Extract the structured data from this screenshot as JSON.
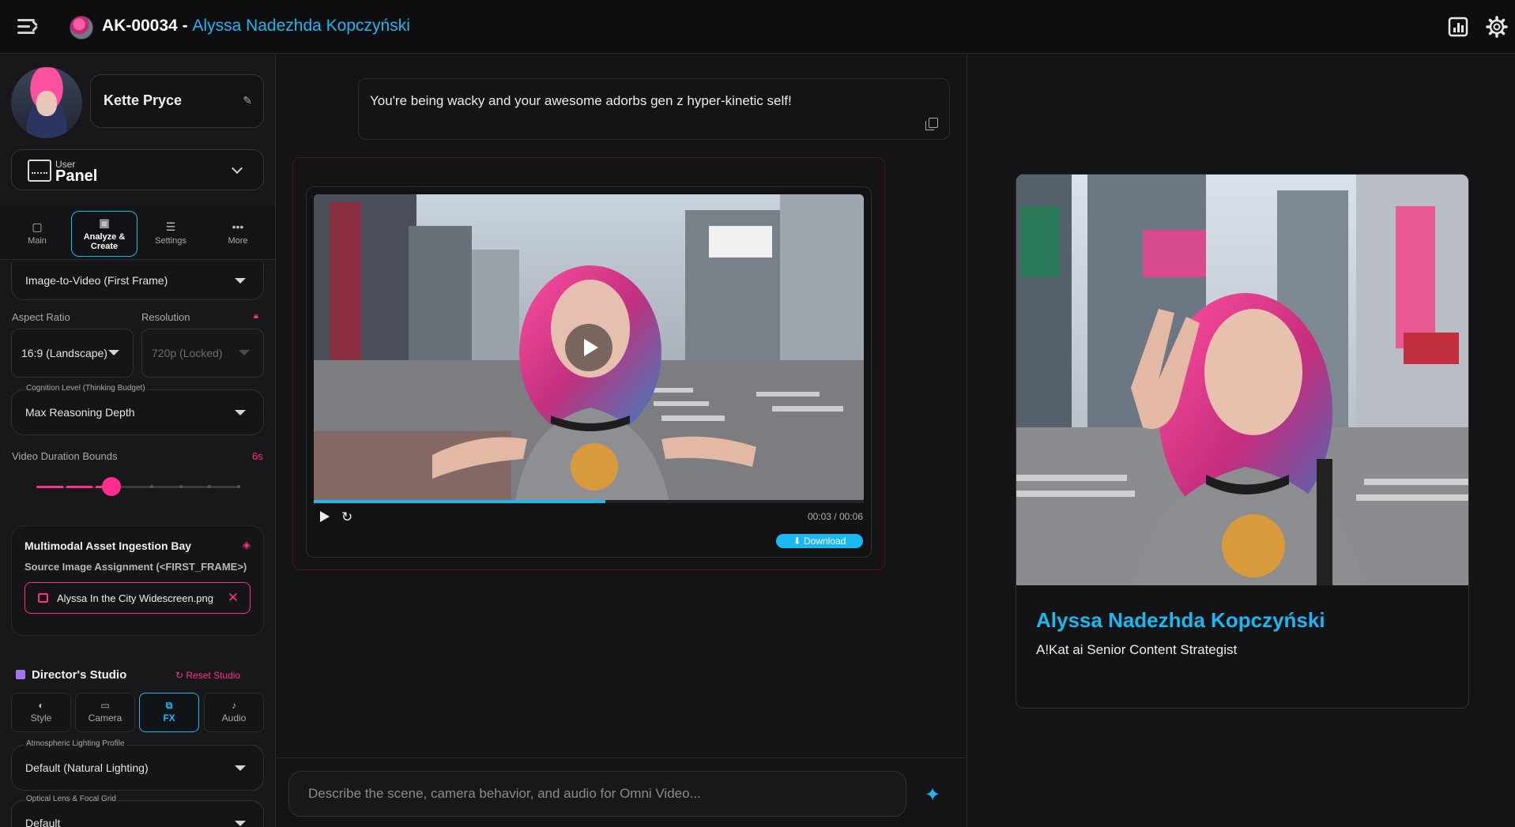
{
  "header": {
    "code": "AK-00034",
    "separator": " - ",
    "name": "Alyssa Nadezhda Kopczyński"
  },
  "sidebar": {
    "profile_name": "Kette Pryce",
    "panel": {
      "small": "User",
      "big": "Panel"
    },
    "nav_tabs": [
      {
        "label": "Main",
        "icon": "chat-icon"
      },
      {
        "label": "Analyze &\nCreate",
        "icon": "chart-icon",
        "active": true
      },
      {
        "label": "Settings",
        "icon": "sliders-icon"
      },
      {
        "label": "More",
        "icon": "more-icon"
      }
    ],
    "mode_value": "Image-to-Video (First Frame)",
    "aspect_ratio": {
      "label": "Aspect Ratio",
      "value": "16:9 (Landscape)"
    },
    "resolution": {
      "label": "Resolution",
      "value": "720p (Locked)"
    },
    "cognition": {
      "label": "Cognition Level (Thinking Budget)",
      "value": "Max Reasoning Depth"
    },
    "duration": {
      "label": "Video Duration Bounds",
      "value": "6s",
      "slider_fraction": 0.37
    },
    "ingest": {
      "title": "Multimodal Asset Ingestion Bay",
      "subtitle": "Source Image Assignment (<FIRST_FRAME>)",
      "file": "Alyssa In the City Widescreen.png"
    },
    "studio": {
      "title": "Director's Studio",
      "reset": "Reset Studio",
      "tabs": [
        {
          "label": "Style",
          "icon": "palette-icon"
        },
        {
          "label": "Camera",
          "icon": "camera-icon"
        },
        {
          "label": "FX",
          "icon": "fx-icon",
          "active": true
        },
        {
          "label": "Audio",
          "icon": "music-note-icon"
        }
      ]
    },
    "lighting": {
      "label": "Atmospheric Lighting Profile",
      "value": "Default (Natural Lighting)"
    },
    "lens": {
      "label": "Optical Lens & Focal Grid",
      "value": "Default"
    }
  },
  "center": {
    "prompt": "You're being wacky and your awesome adorbs gen z hyper-kinetic self!",
    "video": {
      "timecode": "00:03 / 00:06",
      "progress": 0.53,
      "download": "Download"
    },
    "input_placeholder": "Describe the scene, camera behavior, and audio for Omni Video..."
  },
  "right": {
    "name": "Alyssa Nadezhda Kopczyński",
    "role": "A!Kat ai Senior Content Strategist"
  },
  "colors": {
    "accent": "#1ab8f0",
    "pink": "#ff2d8c",
    "bg": "#141416"
  }
}
